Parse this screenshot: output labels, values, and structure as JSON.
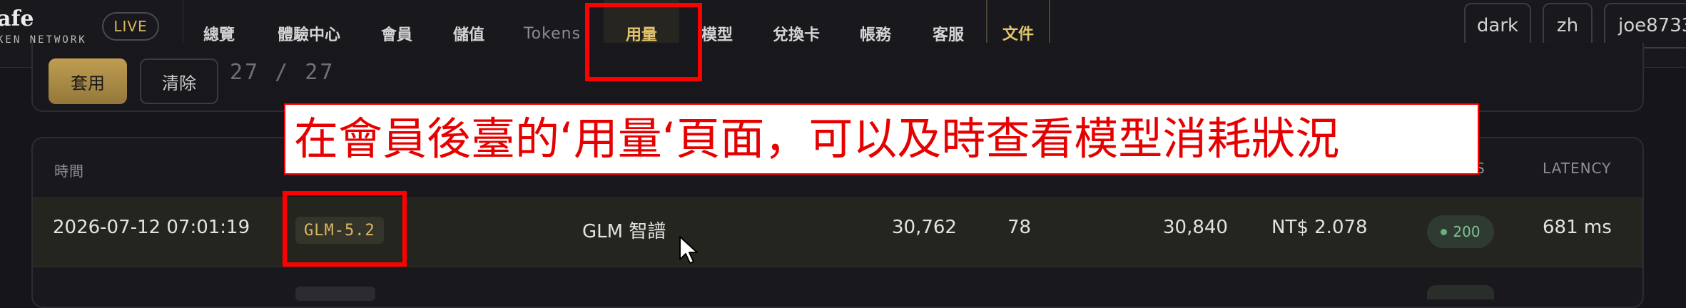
{
  "brand": {
    "name": "afe",
    "sub": "KEN NETWORK",
    "live": "LIVE"
  },
  "nav": {
    "items": [
      {
        "label": "總覽"
      },
      {
        "label": "體驗中心"
      },
      {
        "label": "會員"
      },
      {
        "label": "儲值"
      },
      {
        "label": "Tokens"
      },
      {
        "label": "用量",
        "active": true
      },
      {
        "label": "模型"
      },
      {
        "label": "兌換卡"
      },
      {
        "label": "帳務"
      },
      {
        "label": "客服"
      },
      {
        "label": "文件"
      }
    ],
    "theme_btn": "dark",
    "lang_btn": "zh",
    "user_btn": "joe8733"
  },
  "filter": {
    "apply": "套用",
    "clear": "清除",
    "page_count": "27 / 27"
  },
  "table": {
    "headers": {
      "time": "時間",
      "s": "S",
      "latency": "LATENCY"
    },
    "rows": [
      {
        "time": "2026-07-12 07:01:19",
        "model": "GLM-5.2",
        "provider": "GLM 智譜",
        "input_tokens": "30,762",
        "output_tokens": "78",
        "total_tokens": "30,840",
        "cost": "NT$ 2.078",
        "status": "200",
        "latency": "681 ms"
      }
    ]
  },
  "annotation": {
    "text": "在會員後臺的‘用量‘頁面，可以及時查看模型消耗狀況"
  },
  "colors": {
    "accent": "#c9a64a",
    "highlight": "#ff0000",
    "status_ok": "#62b27b"
  }
}
